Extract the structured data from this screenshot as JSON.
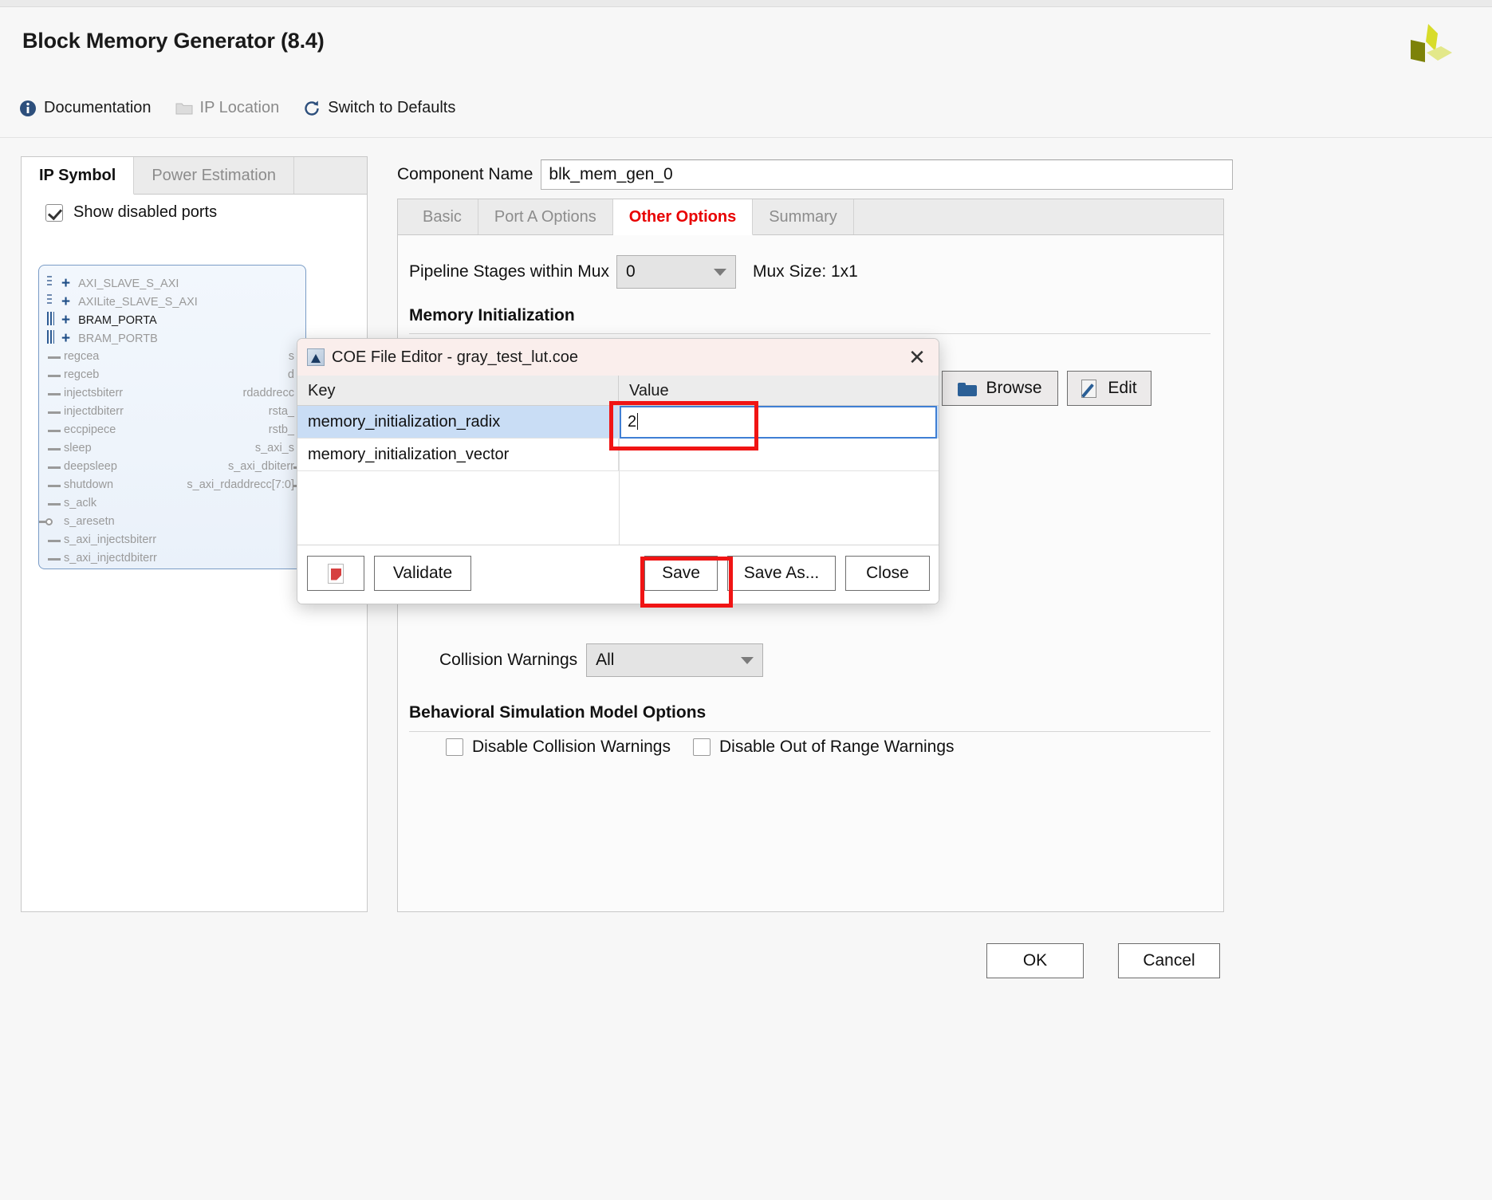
{
  "header": {
    "title": "Block Memory Generator (8.4)",
    "logo_colors": [
      "#d8dc2a",
      "#7d8209",
      "#e3e88a"
    ],
    "toolbar": [
      {
        "label": "Documentation",
        "icon": "info-icon",
        "disabled": false
      },
      {
        "label": "IP Location",
        "icon": "folder-icon",
        "disabled": true
      },
      {
        "label": "Switch to Defaults",
        "icon": "refresh-icon",
        "disabled": false
      }
    ]
  },
  "left_panel": {
    "tabs": [
      {
        "label": "IP Symbol",
        "active": true
      },
      {
        "label": "Power Estimation",
        "active": false
      }
    ],
    "show_disabled_ports": {
      "label": "Show disabled ports",
      "checked": true
    },
    "symbol": {
      "buses": [
        {
          "label": "AXI_SLAVE_S_AXI",
          "enabled": false,
          "pin": "dots"
        },
        {
          "label": "AXILite_SLAVE_S_AXI",
          "enabled": false,
          "pin": "dots"
        },
        {
          "label": "BRAM_PORTA",
          "enabled": true,
          "pin": "bars"
        },
        {
          "label": "BRAM_PORTB",
          "enabled": false,
          "pin": "bars"
        }
      ],
      "left_ports": [
        "regcea",
        "regceb",
        "injectsbiterr",
        "injectdbiterr",
        "eccpipece",
        "sleep",
        "deepsleep",
        "shutdown",
        "s_aclk",
        "s_aresetn",
        "s_axi_injectsbiterr",
        "s_axi_injectdbiterr"
      ],
      "right_ports": [
        "s",
        "d",
        "rdaddrecc",
        "rsta_",
        "rstb_",
        "s_axi_s",
        "s_axi_dbiterr",
        "s_axi_rdaddrecc[7:0]"
      ]
    }
  },
  "component": {
    "label": "Component Name",
    "value": "blk_mem_gen_0"
  },
  "right_panel": {
    "tabs": [
      {
        "label": "Basic",
        "active": false
      },
      {
        "label": "Port A Options",
        "active": false
      },
      {
        "label": "Other Options",
        "active": true
      },
      {
        "label": "Summary",
        "active": false
      }
    ],
    "pipeline": {
      "label": "Pipeline Stages within Mux",
      "value": "0",
      "mux_size": "Mux Size: 1x1"
    },
    "memory_initialization": {
      "title": "Memory Initialization",
      "browse_label": "Browse",
      "edit_label": "Edit"
    },
    "collision_warnings": {
      "label": "Collision Warnings",
      "value": "All"
    },
    "behavioral": {
      "title": "Behavioral Simulation Model Options",
      "checkboxes": [
        {
          "label": "Disable Collision Warnings",
          "checked": false
        },
        {
          "label": "Disable Out of Range Warnings",
          "checked": false
        }
      ]
    }
  },
  "footer": {
    "ok_label": "OK",
    "cancel_label": "Cancel"
  },
  "dialog": {
    "title": "COE File Editor - gray_test_lut.coe",
    "close_glyph": "✕",
    "columns": [
      "Key",
      "Value"
    ],
    "rows": [
      {
        "key": "memory_initialization_radix",
        "value": "2",
        "selected": true,
        "editing": true
      },
      {
        "key": "memory_initialization_vector",
        "value": "",
        "selected": false,
        "editing": false
      }
    ],
    "buttons": {
      "pdf": "pdf-icon",
      "validate": "Validate",
      "save": "Save",
      "save_as": "Save As...",
      "close": "Close"
    }
  },
  "annotations": {
    "highlight_color": "#f01414",
    "boxes": [
      "value-field-highlight",
      "save-button-highlight"
    ]
  }
}
